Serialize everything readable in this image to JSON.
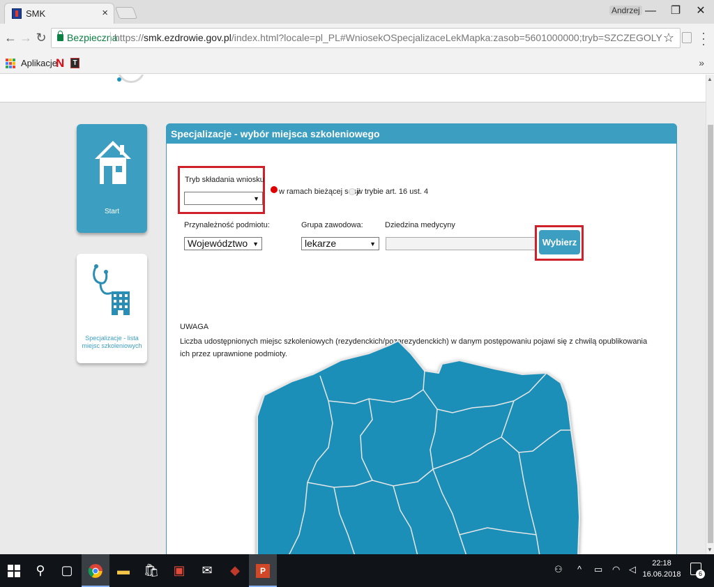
{
  "browser": {
    "tab_title": "SMK",
    "tab_close": "×",
    "user": "Andrzej",
    "secure_label": "Bezpieczna",
    "url_scheme": "https://",
    "url_host": "smk.ezdrowie.gov.pl",
    "url_path": "/index.html?locale=pl_PL#WniosekOSpecjalizaceLekMapka:zasob=5601000000;tryb=SZCZEGOLY",
    "bookmarks": {
      "apps_label": "Aplikacje",
      "more": "»"
    },
    "window_controls": {
      "minimize": "—",
      "maximize": "❐",
      "close": "✕"
    }
  },
  "sidebar": {
    "start_label": "Start",
    "list_label": "Specjalizacje - lista miejsc szkoleniowych"
  },
  "panel": {
    "title": "Specjalizacje - wybór miejsca szkoleniowego",
    "mode_label": "Tryb składania wniosku",
    "mode_value": "",
    "radio_current": "w ramach bieżącej sesji",
    "radio_art": "w trybie art. 16 ust. 4",
    "entity_label": "Przynależność podmiotu:",
    "entity_value": "Województwo",
    "group_label": "Grupa zawodowa:",
    "group_value": "lekarze",
    "field_label": "Dziedzina medycyny",
    "field_value": "",
    "choose_button": "Wybierz",
    "note_title": "UWAGA",
    "note_text": "Liczba udostępnionych miejsc szkoleniowych (rezydenckich/pozarezydenckich) w danym postępowaniu pojawi się z chwilą opublikowania ich przez uprawnione podmioty."
  },
  "colors": {
    "accent": "#3c9fc1",
    "map_fill": "#1b8fb9",
    "highlight_red": "#d0202a"
  },
  "taskbar": {
    "time": "22:18",
    "date": "16.06.2018",
    "notifications": "6"
  }
}
